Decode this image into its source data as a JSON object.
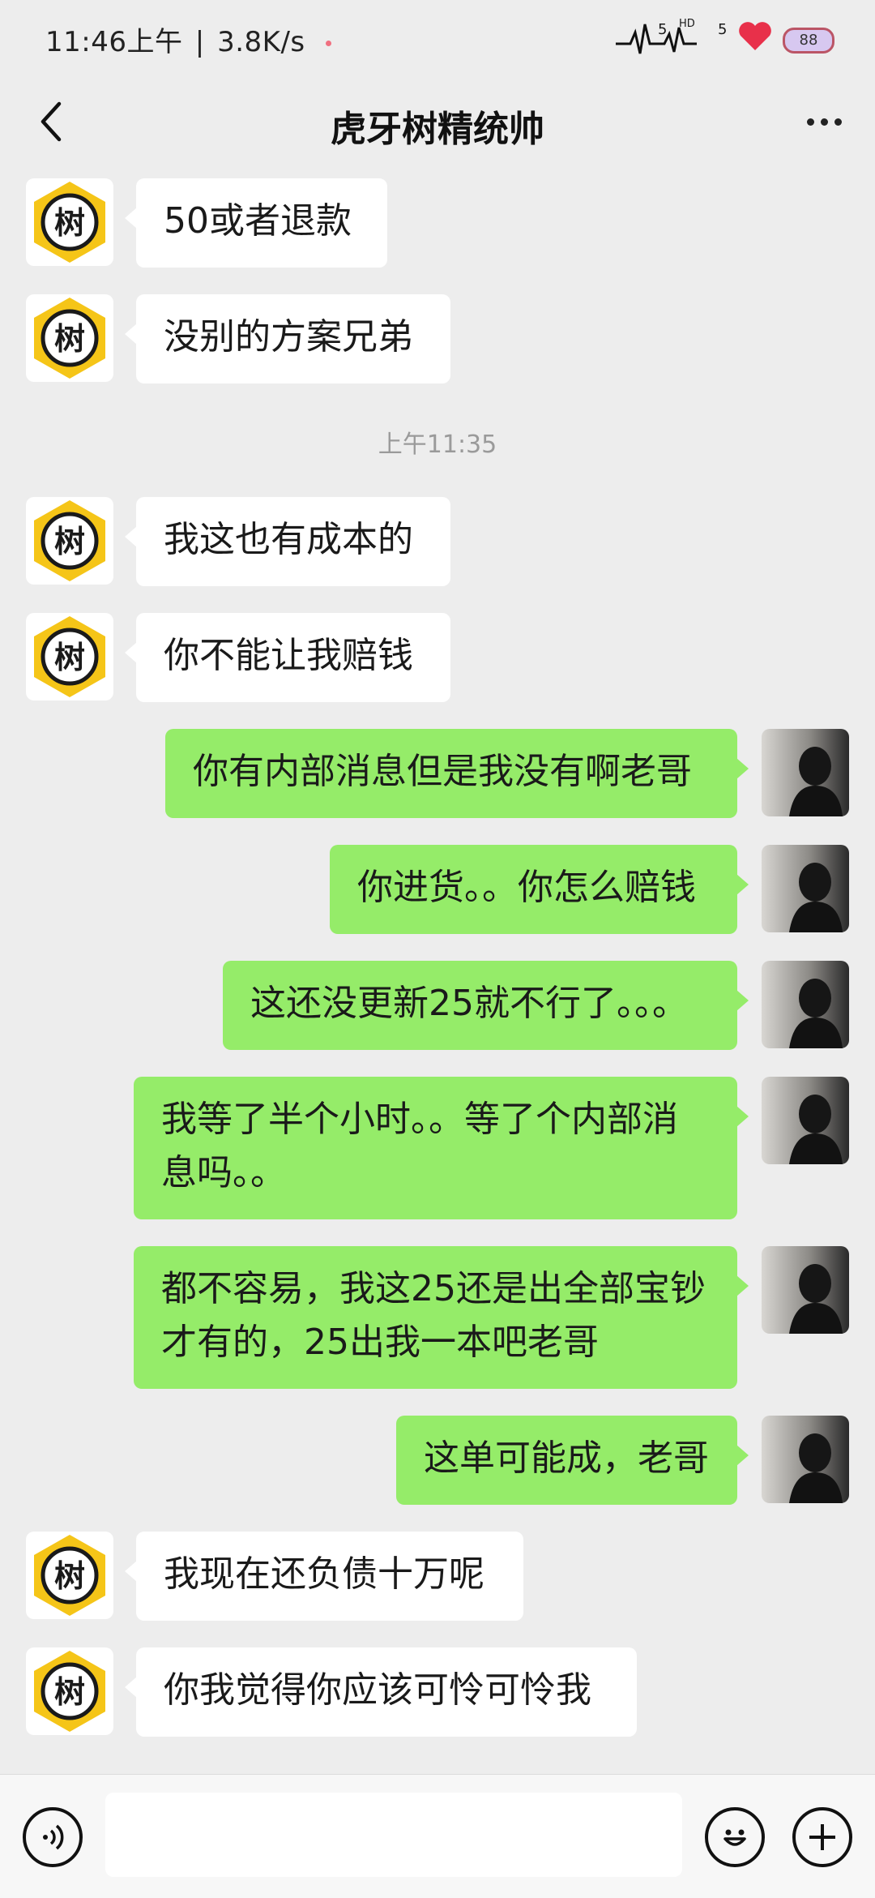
{
  "status_bar": {
    "time": "11:46上午",
    "separator": "|",
    "speed": "3.8K/s",
    "signal1": "5",
    "hd": "HD",
    "signal2": "5",
    "battery": "88"
  },
  "header": {
    "title": "虎牙树精统帅",
    "back_icon": "chevron-left-icon",
    "more_icon": "more-dots-icon"
  },
  "avatar_glyph": "树",
  "messages": [
    {
      "side": "in",
      "text": "50或者退款"
    },
    {
      "side": "in",
      "text": "没别的方案兄弟"
    },
    {
      "type": "time",
      "text": "上午11:35"
    },
    {
      "side": "in",
      "text": "我这也有成本的"
    },
    {
      "side": "in",
      "text": "你不能让我赔钱"
    },
    {
      "side": "out",
      "text": "你有内部消息但是我没有啊老哥"
    },
    {
      "side": "out",
      "text": "你进货。。你怎么赔钱"
    },
    {
      "side": "out",
      "text": "这还没更新25就不行了。。。"
    },
    {
      "side": "out",
      "text": "我等了半个小时。。等了个内部消息吗。。"
    },
    {
      "side": "out",
      "text": "都不容易，我这25还是出全部宝钞才有的，25出我一本吧老哥"
    },
    {
      "side": "out",
      "text": "这单可能成，老哥"
    },
    {
      "side": "in",
      "text": "我现在还负债十万呢"
    },
    {
      "side": "in",
      "text": "你我觉得你应该可怜可怜我"
    }
  ],
  "input_bar": {
    "voice_icon": "voice-icon",
    "emoji_icon": "emoji-icon",
    "plus_icon": "plus-icon",
    "placeholder": ""
  },
  "colors": {
    "background": "#ededed",
    "bubble_out": "#95ec69",
    "bubble_in": "#ffffff",
    "avatar_ring": "#f5c518"
  }
}
